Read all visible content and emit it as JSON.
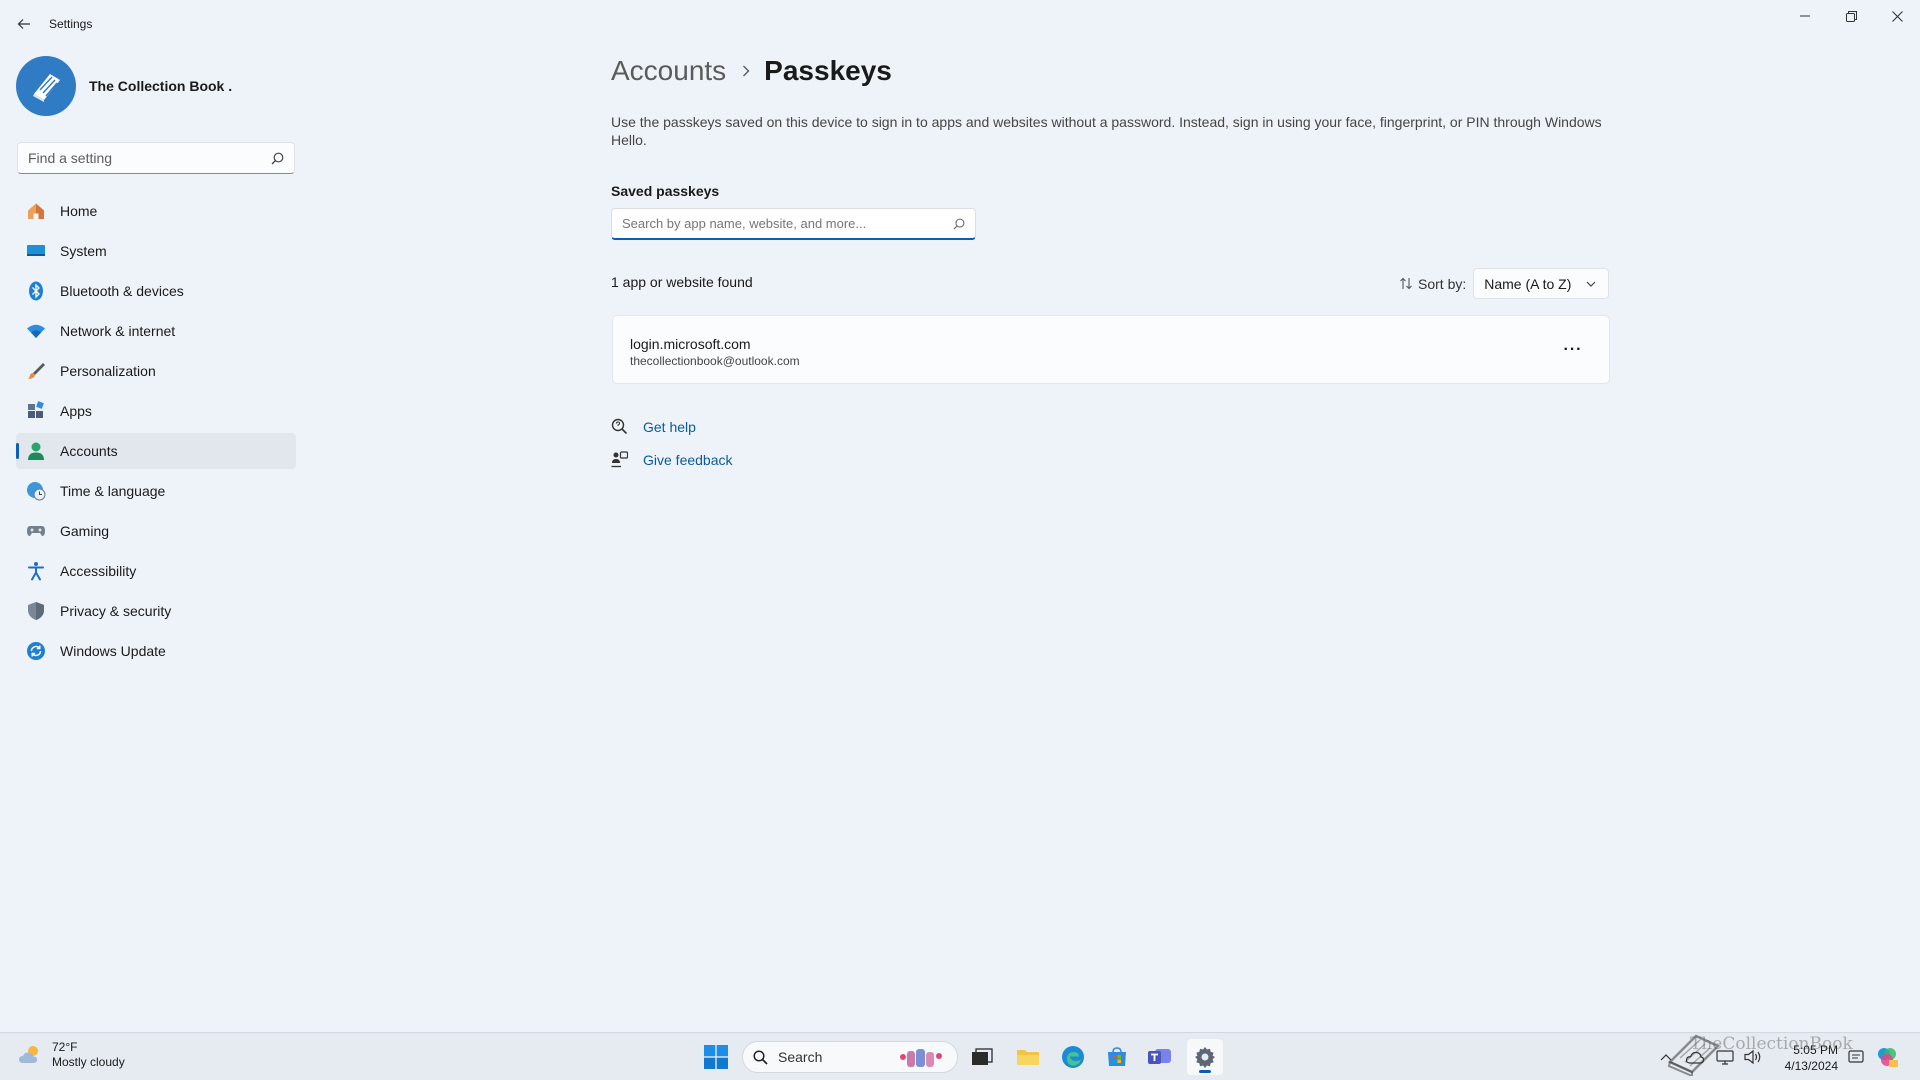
{
  "window": {
    "app_title": "Settings"
  },
  "profile": {
    "name": "The Collection Book ."
  },
  "sidebar": {
    "search_placeholder": "Find a setting",
    "items": [
      {
        "label": "Home",
        "icon": "home-icon"
      },
      {
        "label": "System",
        "icon": "system-icon"
      },
      {
        "label": "Bluetooth & devices",
        "icon": "bluetooth-icon"
      },
      {
        "label": "Network & internet",
        "icon": "wifi-icon"
      },
      {
        "label": "Personalization",
        "icon": "brush-icon"
      },
      {
        "label": "Apps",
        "icon": "apps-icon"
      },
      {
        "label": "Accounts",
        "icon": "accounts-icon",
        "active": true
      },
      {
        "label": "Time & language",
        "icon": "globe-clock-icon"
      },
      {
        "label": "Gaming",
        "icon": "gamepad-icon"
      },
      {
        "label": "Accessibility",
        "icon": "accessibility-icon"
      },
      {
        "label": "Privacy & security",
        "icon": "shield-icon"
      },
      {
        "label": "Windows Update",
        "icon": "update-icon"
      }
    ]
  },
  "main": {
    "breadcrumb_parent": "Accounts",
    "breadcrumb_current": "Passkeys",
    "description": "Use the passkeys saved on this device to sign in to apps and websites without a password. Instead, sign in using your face, fingerprint, or PIN through Windows Hello.",
    "saved_title": "Saved passkeys",
    "search_placeholder": "Search by app name, website, and more...",
    "found_count": "1 app or website found",
    "sort_label": "Sort by:",
    "sort_value": "Name (A to Z)",
    "passkeys": [
      {
        "site": "login.microsoft.com",
        "account": "thecollectionbook@outlook.com"
      }
    ],
    "more_label": "···",
    "links": {
      "help": "Get help",
      "feedback": "Give feedback"
    }
  },
  "taskbar": {
    "weather_temp": "72°F",
    "weather_desc": "Mostly cloudy",
    "search_label": "Search",
    "time": "5:05 PM",
    "date": "4/13/2024"
  },
  "watermark": "TheCollectionBook",
  "colors": {
    "accent": "#0a5fb4",
    "background": "#eef3f9",
    "link": "#0a5a9e"
  }
}
